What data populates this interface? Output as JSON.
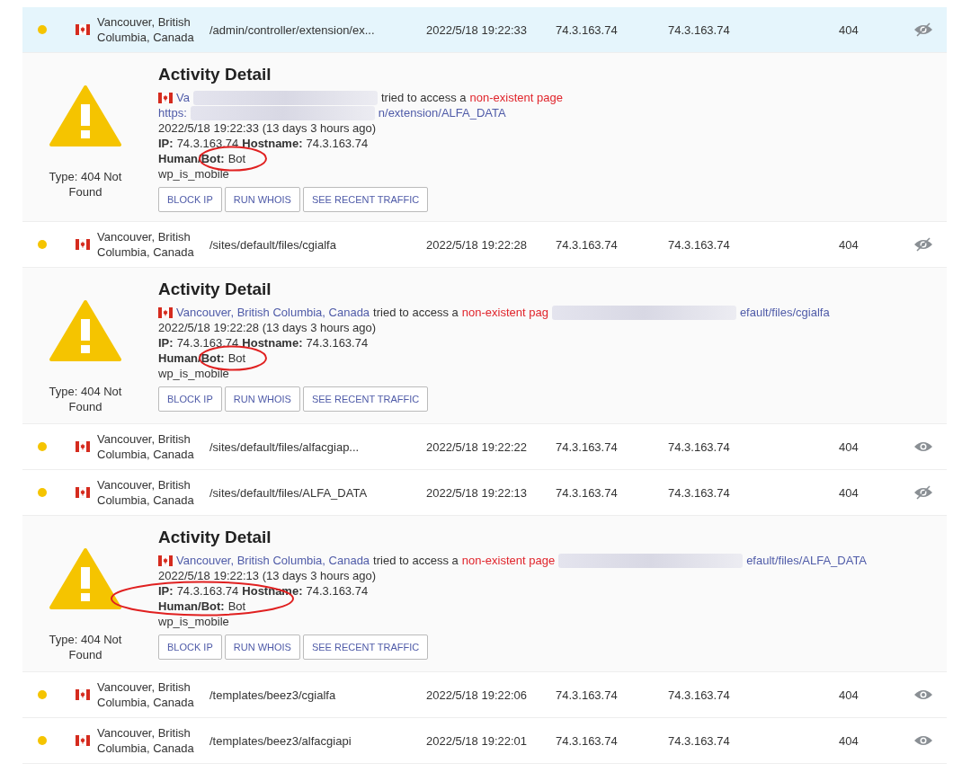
{
  "rows": [
    {
      "location": "Vancouver, British Columbia, Canada",
      "url": "/admin/controller/extension/ex...",
      "time": "2022/5/18 19:22:33",
      "ip": "74.3.163.74",
      "hostname": "74.3.163.74",
      "status": "404",
      "selected": true,
      "expanded": true,
      "detail": {
        "title": "Activity Detail",
        "type_label": "Type: 404 Not Found",
        "lines": [
          [
            {
              "kind": "flag"
            },
            {
              "kind": "link",
              "text": "Va"
            },
            {
              "kind": "redacted"
            },
            {
              "kind": "text",
              "text": "tried to access a"
            },
            {
              "kind": "alert",
              "text": "non-existent page"
            }
          ],
          [
            {
              "kind": "link",
              "text": "https:"
            },
            {
              "kind": "redacted"
            },
            {
              "kind": "link",
              "text": "n/extension/ALFA_DATA"
            }
          ]
        ],
        "date": "2022/5/18 19:22:33 (13 days 3 hours ago)",
        "ip_label": "IP:",
        "ip": "74.3.163.74",
        "hostname_label": "Hostname:",
        "hostname": "74.3.163.74",
        "human_bot_label": "Human/Bot:",
        "human_bot": "Bot",
        "note": "wp_is_mobile",
        "buttons": [
          "BLOCK IP",
          "RUN WHOIS",
          "SEE RECENT TRAFFIC"
        ],
        "human_bot_circled": true
      }
    },
    {
      "location": "Vancouver, British Columbia, Canada",
      "url": "/sites/default/files/cgialfa",
      "time": "2022/5/18 19:22:28",
      "ip": "74.3.163.74",
      "hostname": "74.3.163.74",
      "status": "404",
      "selected": false,
      "expanded": true,
      "detail": {
        "title": "Activity Detail",
        "type_label": "Type: 404 Not Found",
        "lines": [
          [
            {
              "kind": "flag"
            },
            {
              "kind": "link",
              "text": "Vancouver, British Columbia, Canada"
            },
            {
              "kind": "text",
              "text": "tried to access a"
            },
            {
              "kind": "alert",
              "text": "non-existent pag"
            },
            {
              "kind": "redacted"
            },
            {
              "kind": "link",
              "text": "efault/files/cgialfa"
            }
          ]
        ],
        "date": "2022/5/18 19:22:28 (13 days 3 hours ago)",
        "ip_label": "IP:",
        "ip": "74.3.163.74",
        "hostname_label": "Hostname:",
        "hostname": "74.3.163.74",
        "human_bot_label": "Human/Bot:",
        "human_bot": "Bot",
        "note": "wp_is_mobile",
        "buttons": [
          "BLOCK IP",
          "RUN WHOIS",
          "SEE RECENT TRAFFIC"
        ],
        "human_bot_circled": true
      }
    },
    {
      "location": "Vancouver, British Columbia, Canada",
      "url": "/sites/default/files/alfacgiap...",
      "time": "2022/5/18 19:22:22",
      "ip": "74.3.163.74",
      "hostname": "74.3.163.74",
      "status": "404",
      "selected": false,
      "expanded": false
    },
    {
      "location": "Vancouver, British Columbia, Canada",
      "url": "/sites/default/files/ALFA_DATA",
      "time": "2022/5/18 19:22:13",
      "ip": "74.3.163.74",
      "hostname": "74.3.163.74",
      "status": "404",
      "selected": false,
      "expanded": true,
      "detail": {
        "title": "Activity Detail",
        "type_label": "Type: 404 Not Found",
        "lines": [
          [
            {
              "kind": "flag"
            },
            {
              "kind": "link",
              "text": "Vancouver, British Columbia, Canada"
            },
            {
              "kind": "text",
              "text": "tried to access a"
            },
            {
              "kind": "alert",
              "text": "non-existent page"
            },
            {
              "kind": "redacted"
            },
            {
              "kind": "link",
              "text": "efault/files/ALFA_DATA"
            }
          ]
        ],
        "date": "2022/5/18 19:22:13 (13 days 3 hours ago)",
        "ip_label": "IP:",
        "ip": "74.3.163.74",
        "hostname_label": "Hostname:",
        "hostname": "74.3.163.74",
        "human_bot_label": "Human/Bot:",
        "human_bot": "Bot",
        "note": "wp_is_mobile",
        "buttons": [
          "BLOCK IP",
          "RUN WHOIS",
          "SEE RECENT TRAFFIC"
        ],
        "ip_circled": true
      }
    },
    {
      "location": "Vancouver, British Columbia, Canada",
      "url": "/templates/beez3/cgialfa",
      "time": "2022/5/18 19:22:06",
      "ip": "74.3.163.74",
      "hostname": "74.3.163.74",
      "status": "404",
      "selected": false,
      "expanded": false
    },
    {
      "location": "Vancouver, British Columbia, Canada",
      "url": "/templates/beez3/alfacgiapi",
      "time": "2022/5/18 19:22:01",
      "ip": "74.3.163.74",
      "hostname": "74.3.163.74",
      "status": "404",
      "selected": false,
      "expanded": false
    }
  ]
}
